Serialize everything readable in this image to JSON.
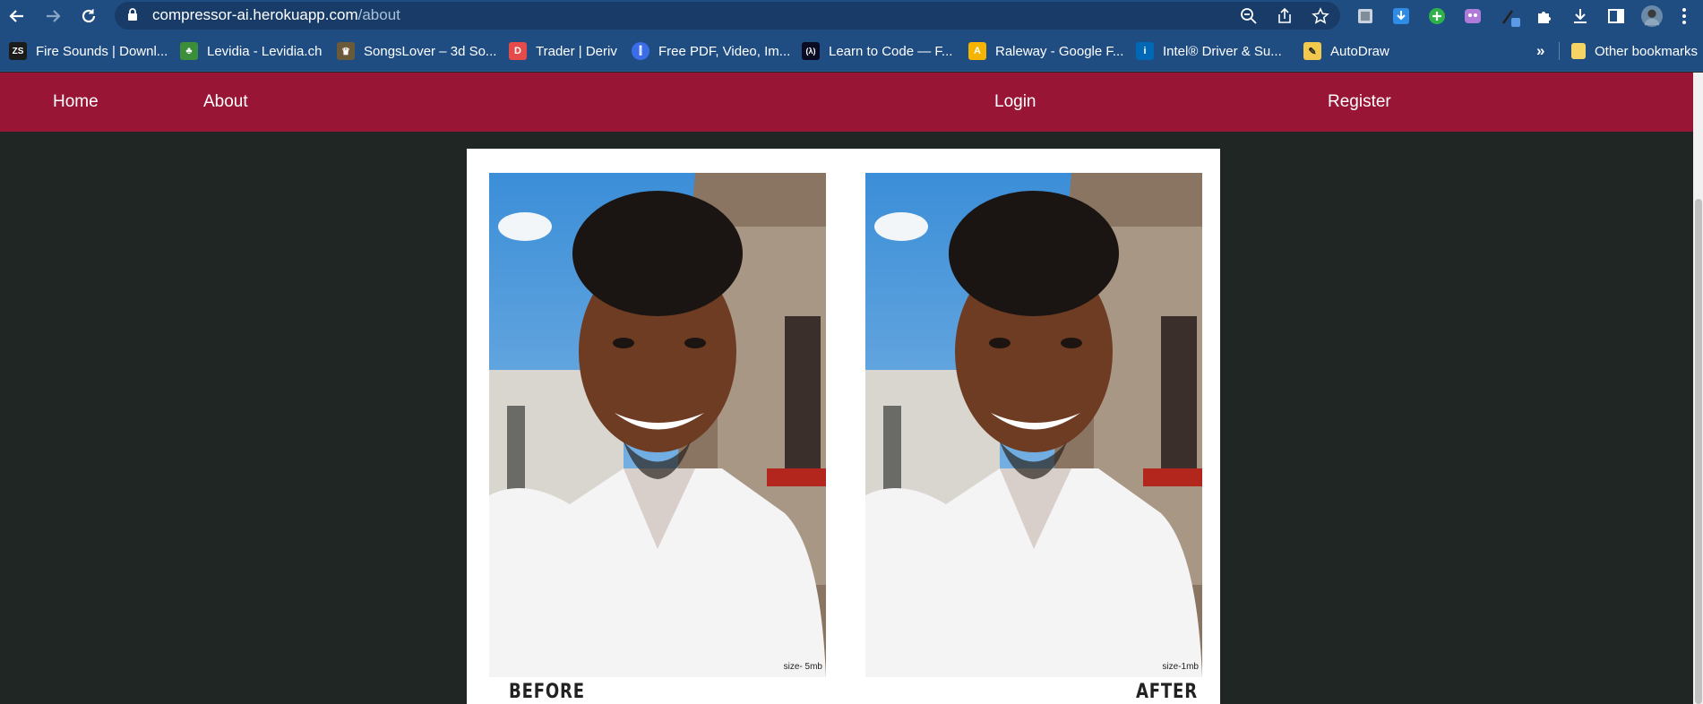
{
  "browser": {
    "url_host": "compressor-ai.herokuapp.com",
    "url_path": "/about",
    "other_bookmarks": "Other bookmarks",
    "overflow": "»"
  },
  "bookmarks": [
    {
      "label": "Fire Sounds | Downl...",
      "icon": "zs-logo-icon",
      "color": "#1b1b1b",
      "glyph": "ZS"
    },
    {
      "label": "Levidia - Levidia.ch",
      "icon": "tree-icon",
      "color": "#3c8f3a",
      "glyph": "♣"
    },
    {
      "label": "SongsLover – 3d So...",
      "icon": "songslover-icon",
      "color": "#6b5a3a",
      "glyph": "♛"
    },
    {
      "label": "Trader | Deriv",
      "icon": "deriv-icon",
      "color": "#e54b4b",
      "glyph": "D"
    },
    {
      "label": "Free PDF, Video, Im...",
      "icon": "pdf-tool-icon",
      "color": "#3c6de8",
      "glyph": "⫿"
    },
    {
      "label": "Learn to Code — F...",
      "icon": "freecodecamp-icon",
      "color": "#0a0a23",
      "glyph": "(λ)"
    },
    {
      "label": "Raleway - Google F...",
      "icon": "google-fonts-icon",
      "color": "#f6b400",
      "glyph": "A"
    },
    {
      "label": "Intel® Driver & Su...",
      "icon": "intel-icon",
      "color": "#0068b5",
      "glyph": "i"
    },
    {
      "label": "AutoDraw",
      "icon": "autodraw-icon",
      "color": "#f2c94c",
      "glyph": "✎"
    }
  ],
  "nav": {
    "home": "Home",
    "about": "About",
    "login": "Login",
    "register": "Register"
  },
  "compare": {
    "before_caption": "BEFORE",
    "after_caption": "AFTER",
    "before_size": "size- 5mb",
    "after_size": "size-1mb"
  },
  "colors": {
    "nav_bg": "#981536",
    "page_bg": "#202623",
    "chrome_bg": "#1f4d82"
  }
}
